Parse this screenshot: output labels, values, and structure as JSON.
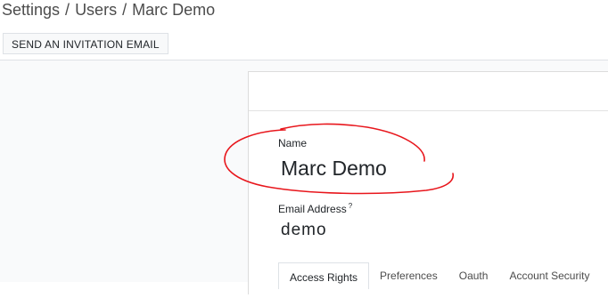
{
  "breadcrumb": {
    "items": [
      "Settings",
      "Users",
      "Marc Demo"
    ],
    "separator": "/"
  },
  "toolbar": {
    "invite_label": "SEND AN INVITATION EMAIL"
  },
  "form": {
    "name_label": "Name",
    "name_value": "Marc Demo",
    "email_label": "Email Address",
    "email_help": "?",
    "email_value": "demo"
  },
  "tabs": [
    {
      "label": "Access Rights",
      "active": true
    },
    {
      "label": "Preferences",
      "active": false
    },
    {
      "label": "Oauth",
      "active": false
    },
    {
      "label": "Account Security",
      "active": false
    }
  ],
  "colors": {
    "annotation": "#e8161c",
    "background": "#f9fafb"
  }
}
